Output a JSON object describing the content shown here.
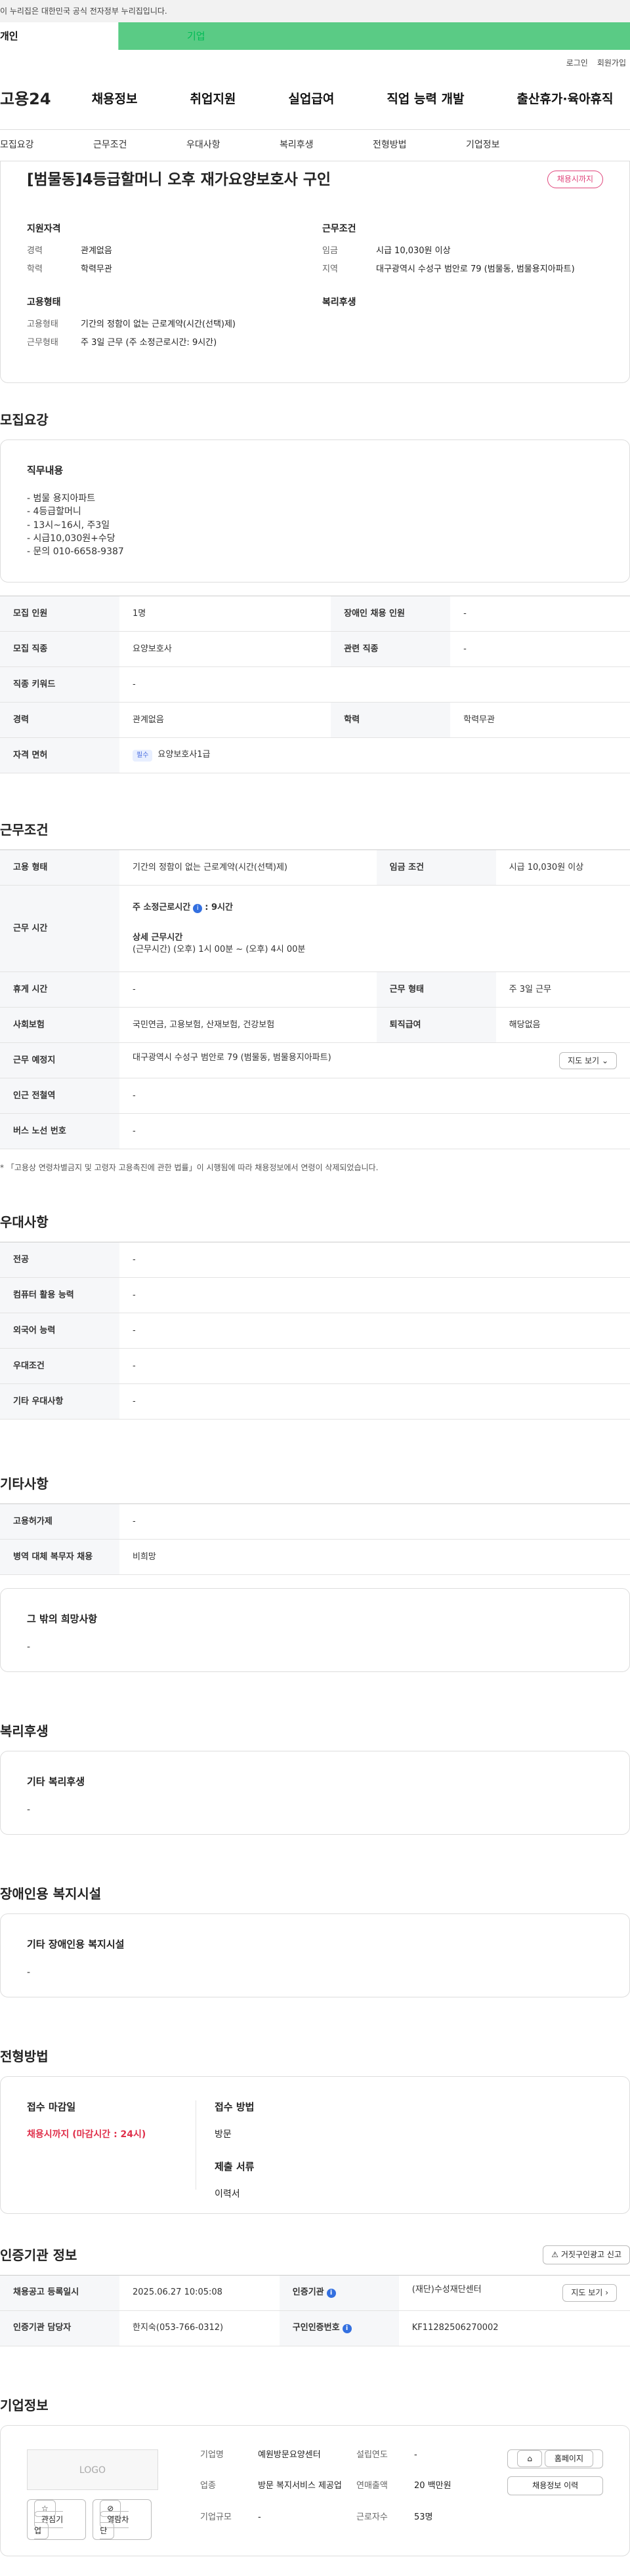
{
  "banner": "이 누리집은 대한민국 공식 전자정부 누리집입니다.",
  "user_tabs": {
    "individual": "개인",
    "company": "기업"
  },
  "util": {
    "login": "로그인",
    "join": "회원가입"
  },
  "gnb": {
    "logo": "고용24",
    "menu": [
      "채용정보",
      "취업지원",
      "실업급여",
      "직업 능력 개발",
      "출산휴가·육아휴직"
    ]
  },
  "subnav": [
    "모집요강",
    "근무조건",
    "우대사항",
    "복리후생",
    "전형방법",
    "기업정보"
  ],
  "summary": {
    "title": "[범물동]4등급할머니 오후 재가요양보호사 구인",
    "deadline_btn": "채용시까지",
    "qual": {
      "h": "지원자격",
      "career_k": "경력",
      "career_v": "관계없음",
      "edu_k": "학력",
      "edu_v": "학력무관"
    },
    "cond": {
      "h": "근무조건",
      "wage_k": "임금",
      "wage_v": "시급 10,030원 이상",
      "loc_k": "지역",
      "loc_v": "대구광역시 수성구 범안로 79 (범물동, 범물용지아파트)"
    },
    "emp": {
      "h": "고용형태",
      "type_k": "고용형태",
      "type_v": "기간의 정함이 없는 근로계약(시간(선택)제)",
      "work_k": "근무형태",
      "work_v": "주 3일 근무 (주 소정근로시간: 9시간)"
    },
    "welfare": {
      "h": "복리후생"
    }
  },
  "recruit": {
    "title": "모집요강",
    "duty_h": "직무내용",
    "duty_lines": [
      "- 범물 용지아파트",
      "- 4등급할머니",
      "- 13시~16시, 주3일",
      "- 시급10,030원+수당",
      "- 문의 010-6658-9387"
    ],
    "rows": [
      {
        "k1": "모집 인원",
        "v1": "1명",
        "k2": "장애인 채용 인원",
        "v2": "-"
      },
      {
        "k1": "모집 직종",
        "v1": "요양보호사",
        "k2": "관련 직종",
        "v2": "-"
      },
      {
        "k1": "직종 키워드",
        "v1": "-"
      },
      {
        "k1": "경력",
        "v1": "관계없음",
        "k2": "학력",
        "v2": "학력무관"
      },
      {
        "k1": "자격 면허",
        "badge": "필수",
        "v1": "요양보호사1급"
      }
    ]
  },
  "work": {
    "title": "근무조건",
    "type_k": "고용 형태",
    "type_v": "기간의 정함이 없는 근로계약(시간(선택)제)",
    "wage_k": "임금 조건",
    "wage_v": "시급 10,030원 이상",
    "hours_k": "근무 시간",
    "hours_week_label": "주 소정근로시간",
    "hours_week_v": ": 9시간",
    "hours_detail_h": "상세 근무시간",
    "hours_detail_v": "(근무시간) (오후) 1시 00분 ~ (오후) 4시 00분",
    "rest_k": "휴게 시간",
    "rest_v": "-",
    "form_k": "근무 형태",
    "form_v": "주 3일 근무",
    "ins_k": "사회보험",
    "ins_v": "국민연금, 고용보험, 산재보험, 건강보험",
    "sev_k": "퇴직급여",
    "sev_v": "해당없음",
    "place_k": "근무 예정지",
    "place_v": "대구광역시 수성구 범안로 79 (범물동, 범물용지아파트)",
    "map_btn": "지도 보기",
    "subway_k": "인근 전철역",
    "subway_v": "-",
    "bus_k": "버스 노선 번호",
    "bus_v": "-",
    "note": "* 「고용상 연령차별금지 및 고령자 고용촉진에 관한 법률」이 시행됨에 따라 채용정보에서 연령이 삭제되었습니다."
  },
  "pref": {
    "title": "우대사항",
    "rows": [
      {
        "k": "전공",
        "v": "-"
      },
      {
        "k": "컴퓨터 활용 능력",
        "v": "-"
      },
      {
        "k": "외국어 능력",
        "v": "-"
      },
      {
        "k": "우대조건",
        "v": "-"
      },
      {
        "k": "기타 우대사항",
        "v": "-"
      }
    ]
  },
  "etc": {
    "title": "기타사항",
    "rows": [
      {
        "k": "고용허가제",
        "v": "-"
      },
      {
        "k": "병역 대체 복무자 채용",
        "v": "비희망"
      }
    ],
    "box_h": "그 밖의 희망사항",
    "box_v": "-"
  },
  "welfare": {
    "title": "복리후생",
    "box_h": "기타 복리후생",
    "box_v": "-"
  },
  "disabled": {
    "title": "장애인용 복지시설",
    "box_h": "기타 장애인용 복지시설",
    "box_v": "-"
  },
  "apply": {
    "title": "전형방법",
    "deadline_h": "접수 마감일",
    "deadline_v": "채용시까지 (마감시간 : 24시)",
    "method_h": "접수 방법",
    "method_v": "방문",
    "docs_h": "제출 서류",
    "docs_v": "이력서"
  },
  "cert": {
    "title": "인증기관 정보",
    "report_btn": "거짓구인광고 신고",
    "reg_k": "채용공고 등록일시",
    "reg_v": "2025.06.27 10:05:08",
    "org_k": "인증기관",
    "org_v": "(재단)수성재단센터",
    "map_btn": "지도 보기",
    "mgr_k": "인증기관 담당자",
    "mgr_v": "한지숙(053-766-0312)",
    "id_k": "구인인증번호",
    "id_v": "KF11282506270002"
  },
  "corp": {
    "title": "기업정보",
    "logo": "LOGO",
    "fav_btn": "관심기업",
    "block_btn": "열람차단",
    "name_k": "기업명",
    "name_v": "예원방문요양센터",
    "ind_k": "업종",
    "ind_v": "방문 복지서비스 제공업",
    "size_k": "기업규모",
    "size_v": "-",
    "year_k": "설립연도",
    "year_v": "-",
    "sales_k": "연매출액",
    "sales_v": "20 백만원",
    "emp_k": "근로자수",
    "emp_v": "53명",
    "home_btn": "홈페이지",
    "history_btn": "채용정보 이력"
  }
}
